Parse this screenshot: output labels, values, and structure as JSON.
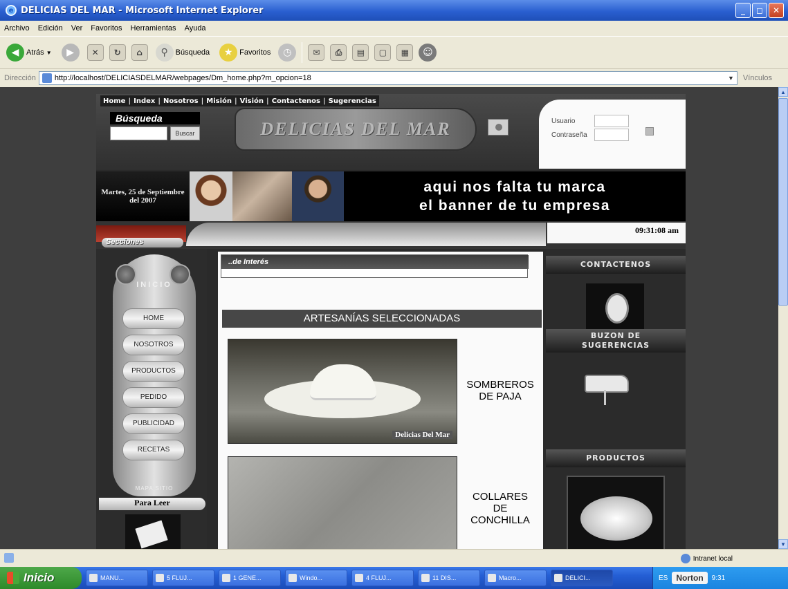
{
  "window": {
    "title": "DELICIAS DEL MAR - Microsoft Internet Explorer",
    "buttons": [
      "_",
      "◻",
      "✕"
    ]
  },
  "menu": [
    "Archivo",
    "Edición",
    "Ver",
    "Favoritos",
    "Herramientas",
    "Ayuda"
  ],
  "toolbar": {
    "back": "Atrás",
    "search": "Búsqueda",
    "favorites": "Favoritos"
  },
  "address": {
    "label": "Dirección",
    "url": "http://localhost/DELICIASDELMAR/webpages/Dm_home.php?m_opcion=18",
    "links": "Vínculos"
  },
  "site": {
    "topnav": [
      "Home",
      "Index",
      "Nosotros",
      "Misión",
      "Visión",
      "Contactenos",
      "Sugerencias"
    ],
    "search_title": "Búsqueda",
    "search_button": "Buscar",
    "logo": "DELICIAS DEL MAR",
    "login": {
      "user_label": "Usuario",
      "password_label": "Contraseña"
    },
    "date": "Martes, 25 de Septiembre del 2007",
    "banner_line1": "aqui nos falta tu marca",
    "banner_line2": "el banner de tu empresa",
    "secciones": "Secciones",
    "clock": "09:31:08 am",
    "inicio": "INICIO",
    "nav": [
      "HOME",
      "NOSOTROS",
      "PRODUCTOS",
      "PEDIDO",
      "PUBLICIDAD",
      "RECETAS"
    ],
    "mapa": "MAPA SITIO",
    "para_leer": "Para Leer",
    "interes": "..de Interés",
    "art_header": "ARTESANÍAS SELECCIONADAS",
    "products": [
      {
        "line1": "SOMBREROS",
        "line2": "DE PAJA",
        "line3": ""
      },
      {
        "line1": "COLLARES",
        "line2": "DE",
        "line3": "CONCHILLA"
      }
    ],
    "watermark": "Delicias Del Mar",
    "right": {
      "contact": "CONTACTENOS",
      "buzon_line1": "BUZON DE",
      "buzon_line2": "SUGERENCIAS",
      "productos": "PRODUCTOS"
    }
  },
  "status": {
    "zone": "Intranet local"
  },
  "taskbar": {
    "start": "Inicio",
    "tasks": [
      "MANU...",
      "5 FLUJ...",
      "1 GENE...",
      "Windo...",
      "4 FLUJ...",
      "11 DIS...",
      "Macro...",
      "DELICI..."
    ],
    "lang": "ES",
    "norton": "Norton",
    "time": "9:31"
  },
  "colors": {
    "title_blue": "#245ed4",
    "start_green": "#2e8a2a"
  }
}
